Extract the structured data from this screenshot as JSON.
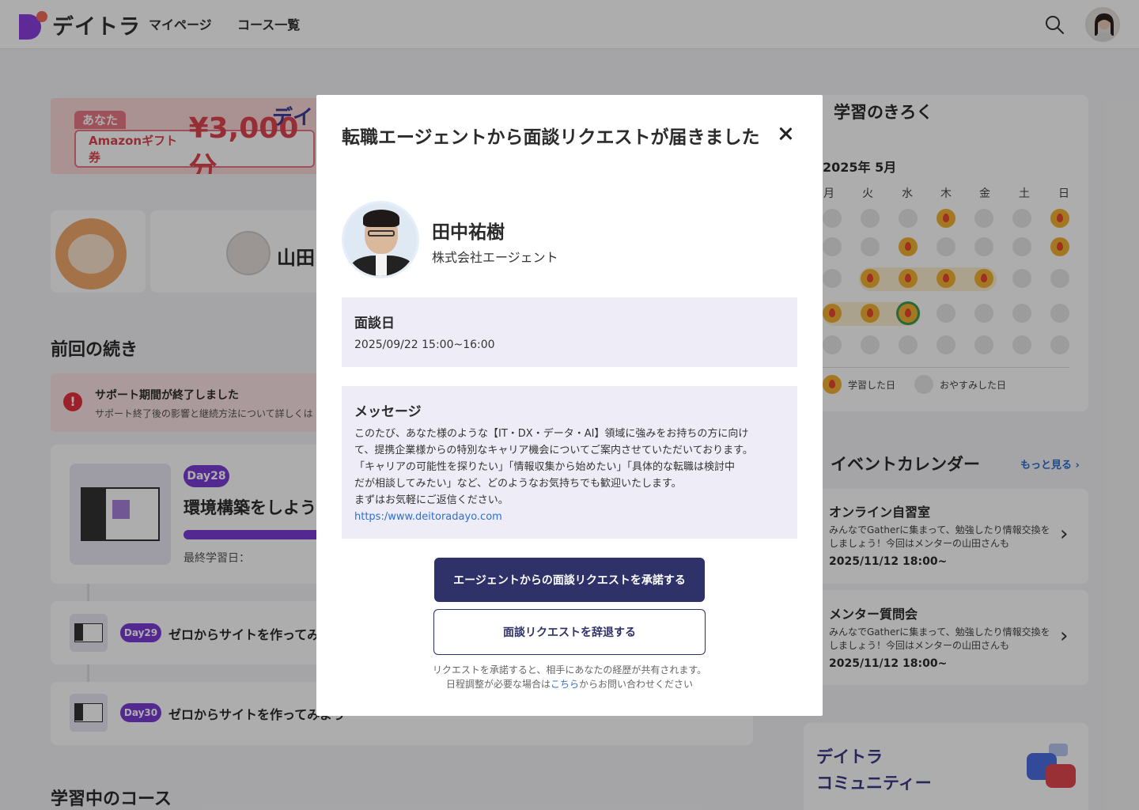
{
  "header": {
    "logo_text": "デイトラ",
    "nav": [
      "マイページ",
      "コース一覧"
    ]
  },
  "banner": {
    "you_label": "あなた",
    "gift_label": "Amazonギフト券",
    "amount": "¥3,000分",
    "brand_partial": "デイ"
  },
  "profile": {
    "user_name_partial": "山田"
  },
  "continue_section": {
    "title": "前回の続き",
    "alert_title": "サポート期間が終了しました",
    "alert_sub": "サポート終了後の影響と継続方法について詳しくは",
    "main_course": {
      "day": "Day28",
      "title": "環境構築をしよう",
      "last_study_label": "最終学習日："
    },
    "rows": [
      {
        "day": "Day29",
        "title": "ゼロからサイトを作ってみ"
      },
      {
        "day": "Day30",
        "title": "ゼロからサイトを作ってみよう"
      }
    ]
  },
  "learning_section": {
    "title": "学習中のコース"
  },
  "calendar": {
    "title": "学習のきろく",
    "month": "2025年 5月",
    "weekdays": [
      "月",
      "火",
      "水",
      "木",
      "金",
      "土",
      "日"
    ],
    "legend": {
      "studied": "学習した日",
      "rest": "おやすみした日"
    },
    "studied_cells": [
      [
        0,
        3
      ],
      [
        0,
        6
      ],
      [
        1,
        2
      ],
      [
        1,
        6
      ],
      [
        2,
        1
      ],
      [
        2,
        2
      ],
      [
        2,
        3
      ],
      [
        2,
        4
      ],
      [
        3,
        0
      ],
      [
        3,
        1
      ],
      [
        3,
        2
      ]
    ],
    "today_cell": [
      3,
      2
    ]
  },
  "events": {
    "title": "イベントカレンダー",
    "more_link": "もっと見る",
    "items": [
      {
        "name": "オンライン自習室",
        "desc": "みんなでGatherに集まって、勉強したり情報交換をしましょう！今回はメンターの山田さんも",
        "date": "2025/11/12 18:00~"
      },
      {
        "name": "メンター質問会",
        "desc": "みんなでGatherに集まって、勉強したり情報交換をしましょう！今回はメンターの山田さんも",
        "date": "2025/11/12 18:00~"
      }
    ]
  },
  "community": {
    "line1": "デイトラ",
    "line2": "コミュニティー"
  },
  "modal": {
    "title": "転職エージェントから面談リクエストが届きました",
    "agent_name": "田中祐樹",
    "agent_company": "株式会社エージェント",
    "date_label": "面談日",
    "date_value": "2025/09/22 15:00~16:00",
    "message_label": "メッセージ",
    "message_lines": [
      "このたび、あなた様のような【IT・DX・データ・AI】領域に強みをお持ちの方に向け",
      "て、提携企業様からの特別なキャリア機会についてご案内させていただいております。",
      "「キャリアの可能性を探りたい」「情報収集から始めたい」「具体的な転職は検討中",
      "だが相談してみたい」など、どのようなお気持ちでも歓迎いたします。",
      "まずはお気軽にご返信ください。"
    ],
    "message_link": "https:/www.deitoradayo.com",
    "accept_button": "エージェントからの面談リクエストを承諾する",
    "decline_button": "面談リクエストを辞退する",
    "note_line1": "リクエストを承諾すると、相手にあなたの経歴が共有されます。",
    "note_line2_pre": "日程調整が必要な場合は",
    "note_line2_link": "こちら",
    "note_line2_post": "からお問い合わせください"
  }
}
